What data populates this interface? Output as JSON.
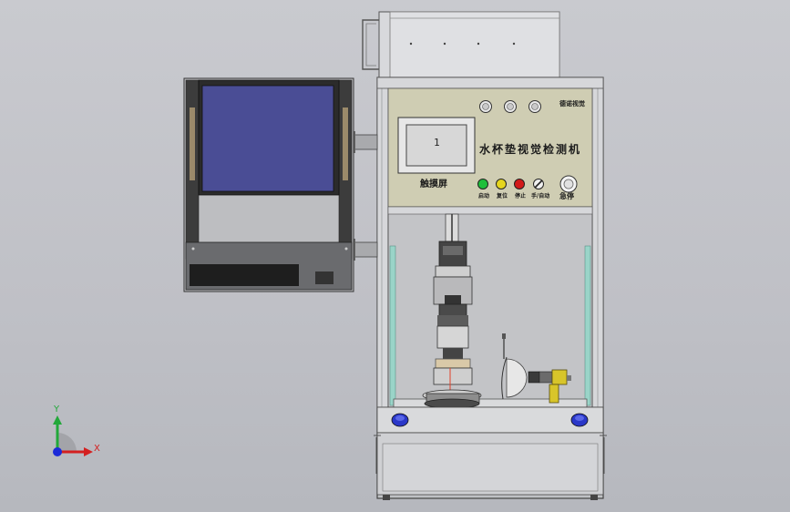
{
  "machine": {
    "title": "水杯垫视觉检测机",
    "brand": "德诺视觉",
    "touch_screen_label": "触摸屏",
    "emergency_label": "急停",
    "touch_screen_digit": "1",
    "indicator_lamps": [
      {
        "label": "启动",
        "color": "#1fbf3a"
      },
      {
        "label": "复位",
        "color": "#e5d51e"
      },
      {
        "label": "停止",
        "color": "#d21a1a"
      },
      {
        "label": "手/自动",
        "color": "#3a3a3a"
      }
    ],
    "top_buttons": 3
  },
  "triad": {
    "x_label": "X",
    "y_label": "Y",
    "x_color": "#d42020",
    "y_color": "#22a83a",
    "z_color": "#1c2ad8"
  },
  "monitor": {
    "screen_color": "#4a4d95"
  }
}
